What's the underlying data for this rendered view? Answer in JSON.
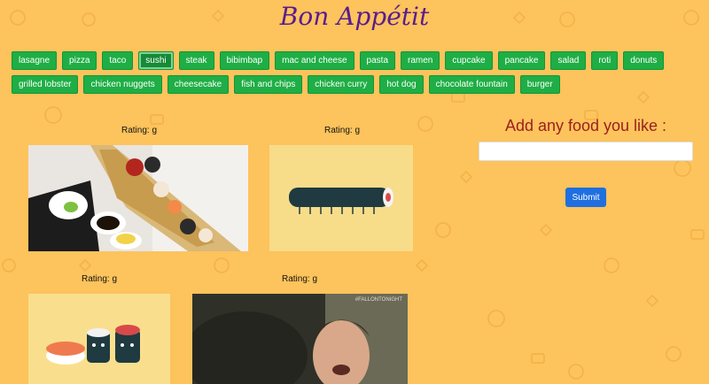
{
  "header": {
    "title": "Bon Appétit"
  },
  "food_buttons": {
    "row1": [
      "lasagne",
      "pizza",
      "taco",
      "sushi",
      "steak",
      "bibimbap",
      "mac and cheese",
      "pasta",
      "ramen",
      "cupcake",
      "pancake",
      "salad",
      "roti",
      "donuts"
    ],
    "row2": [
      "grilled lobster",
      "chicken nuggets",
      "cheesecake",
      "fish and chips",
      "chicken curry",
      "hot dog",
      "chocolate fountain",
      "burger"
    ],
    "active": "sushi"
  },
  "gifs": [
    {
      "rating": "Rating: g"
    },
    {
      "rating": "Rating: g"
    },
    {
      "rating": "Rating: g"
    },
    {
      "rating": "Rating: g",
      "watermark": "#FALLONTONIGHT"
    }
  ],
  "form": {
    "label": "Add any food you like :",
    "input_value": "",
    "submit_label": "Submit"
  },
  "colors": {
    "background": "#fdc35c",
    "title": "#5a1d8e",
    "button": "#1fae45",
    "form_label": "#9b1f1f",
    "submit": "#1f6fe0"
  }
}
